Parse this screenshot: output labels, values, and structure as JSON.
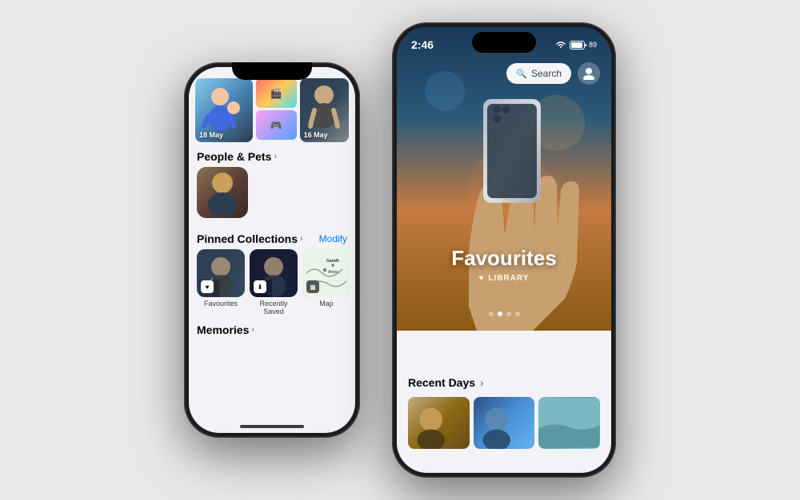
{
  "leftPhone": {
    "photos": {
      "date1": "18 May",
      "date2": "16 May"
    },
    "peoplePets": {
      "title": "People & Pets",
      "chevron": "›"
    },
    "pinnedCollections": {
      "title": "Pinned Collections",
      "chevron": "›",
      "modifyLabel": "Modify",
      "items": [
        {
          "label": "Favourites",
          "icon": "♥"
        },
        {
          "label": "Recently Saved",
          "icon": "⬇"
        },
        {
          "label": "Map",
          "icon": "■"
        }
      ]
    },
    "memories": {
      "title": "Memories",
      "chevron": "›"
    }
  },
  "rightPhone": {
    "statusBar": {
      "time": "2:46",
      "wifi": "wifi",
      "battery": "89"
    },
    "search": {
      "label": "Search",
      "icon": "🔍"
    },
    "hero": {
      "title": "Favourites",
      "subtitle": "LIBRARY",
      "heartIcon": "♥"
    },
    "recentDays": {
      "title": "Recent Days",
      "chevron": "›"
    },
    "dots": [
      1,
      2,
      3,
      4
    ],
    "activeDotsIndex": 1
  }
}
